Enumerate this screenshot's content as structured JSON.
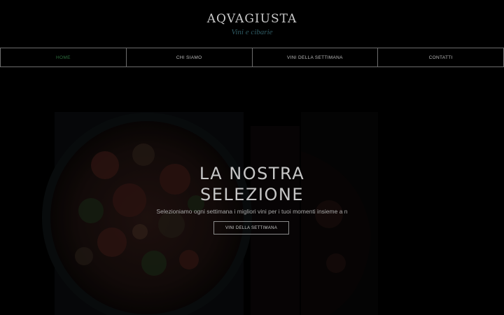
{
  "header": {
    "logo": "AQVAGIUSTA",
    "tagline": "Vini e cibarie"
  },
  "nav": {
    "items": [
      {
        "label": "HOME",
        "active": true
      },
      {
        "label": "CHI SIAMO",
        "active": false
      },
      {
        "label": "VINI DELLA SETTIMANA",
        "active": false
      },
      {
        "label": "CONTATTI",
        "active": false
      }
    ]
  },
  "hero": {
    "title_line1": "LA NOSTRA",
    "title_line2": "SELEZIONE",
    "subtitle": "Selezioniamo ogni settimana i migliori vini per i tuoi momenti insieme a n",
    "cta_label": "VINI DELLA SETTIMANA"
  },
  "colors": {
    "background": "#000000",
    "nav_active": "#2f6e3e",
    "tagline": "#2f5a63",
    "border": "#6c6c6c"
  }
}
